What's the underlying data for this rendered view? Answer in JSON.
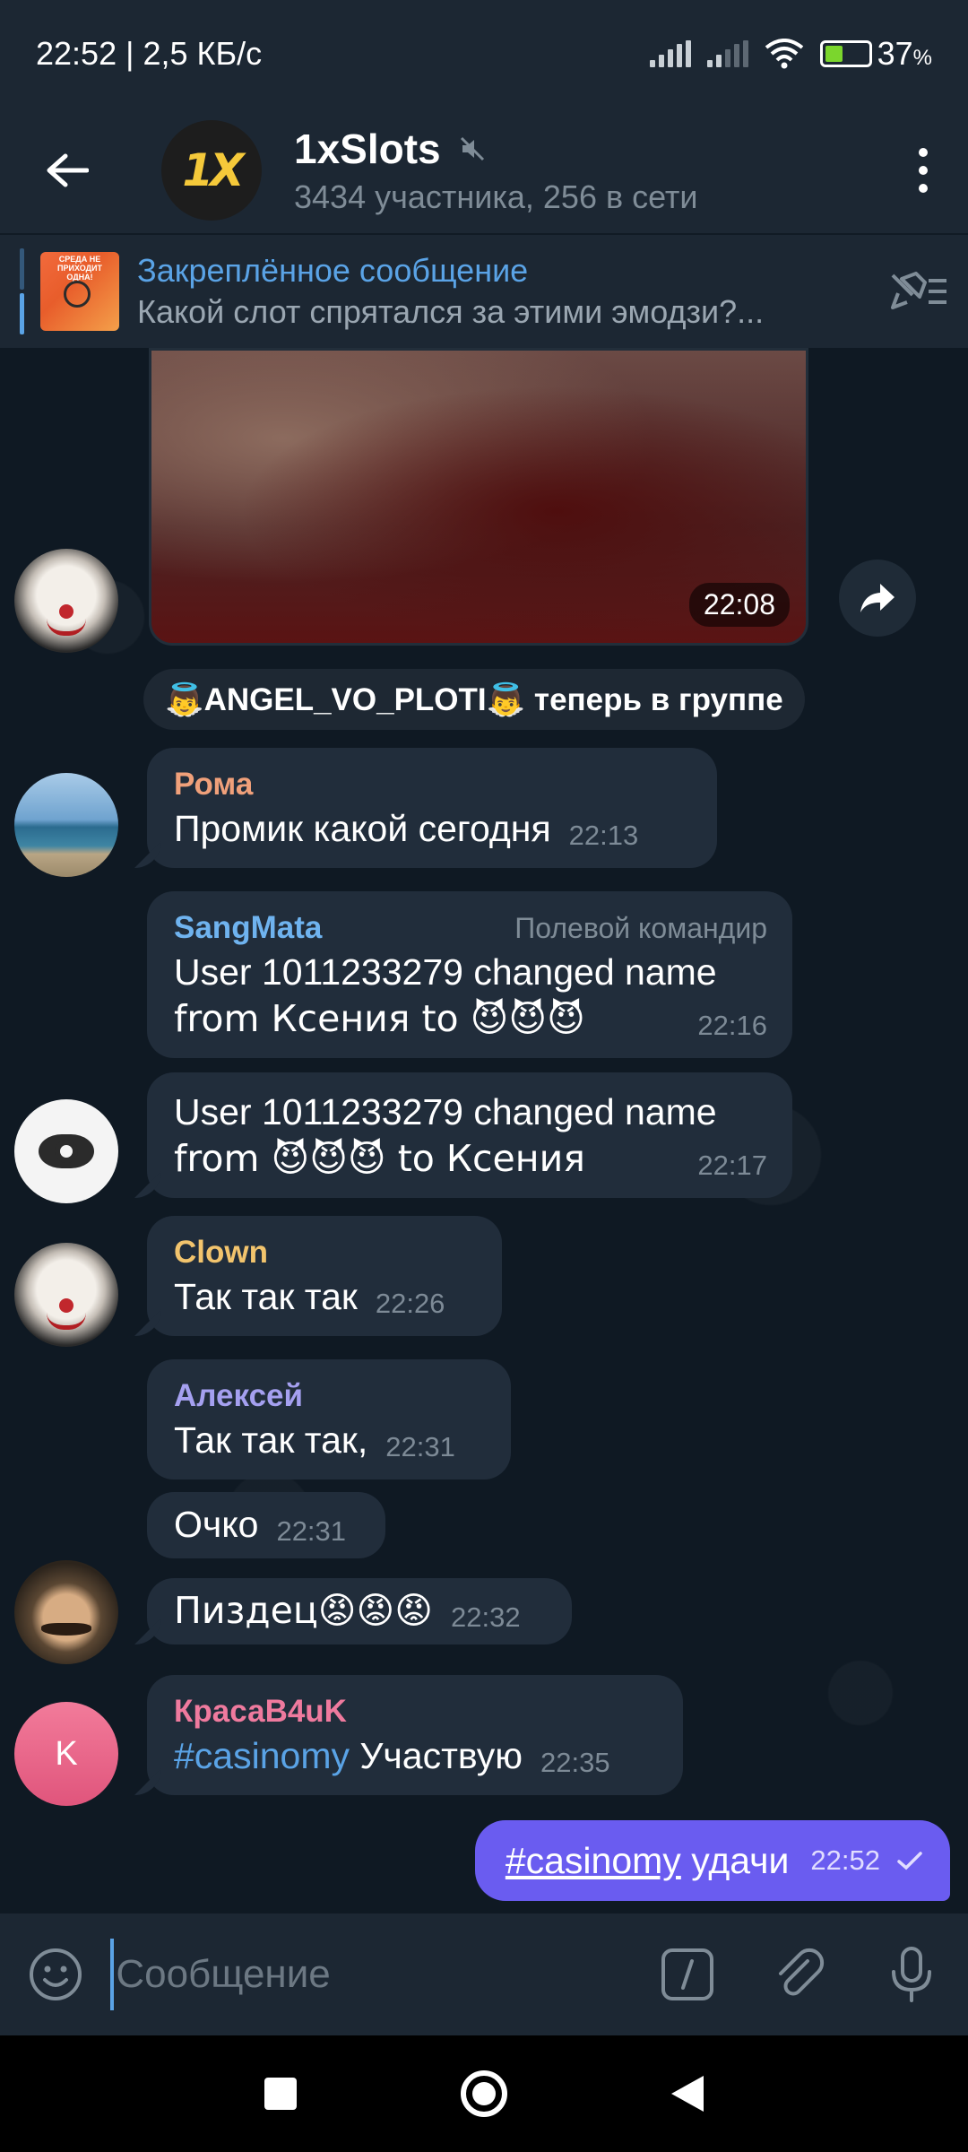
{
  "status_bar": {
    "time": "22:52 | 2,5 КБ/с",
    "battery_percent": "37",
    "battery_suffix": "%",
    "battery_level": 0.37,
    "icons": [
      "signal-icon",
      "signal-icon",
      "wifi-icon",
      "battery-icon"
    ]
  },
  "header": {
    "title": "1xSlots",
    "subtitle": "3434 участника, 256 в сети",
    "avatar_text": "1X",
    "muted": true
  },
  "pinned": {
    "title": "Закреплённое сообщение",
    "preview": "Какой слот спрятался за этими эмодзи?...",
    "thumb_text": "СРЕДА НЕ ПРИХОДИТ ОДНА!"
  },
  "media": {
    "time": "22:08"
  },
  "service": {
    "text": "👼ANGEL_VO_PLOTI👼 теперь в группе"
  },
  "messages": [
    {
      "name": "Рома",
      "name_color": "#f0a07a",
      "text": "Промик какой сегодня",
      "time": "22:13"
    },
    {
      "name": "SangMata",
      "name_color": "#6fb3ef",
      "role": "Полевой командир",
      "line1": "User 1011233279 changed name",
      "line2": "from Ксения to 😈😈😈",
      "time": "22:16"
    },
    {
      "line1": "User 1011233279 changed name",
      "line2": "from 😈😈😈 to Ксения",
      "time": "22:17"
    },
    {
      "name": "Clown",
      "name_color": "#f2c46d",
      "text": "Так так так",
      "time": "22:26"
    },
    {
      "name": "Алексей",
      "name_color": "#a5a0f0",
      "text": "Так так так,",
      "time": "22:31"
    },
    {
      "text": "Очко",
      "time": "22:31"
    },
    {
      "text": "Пиздец😡😡😡",
      "time": "22:32"
    },
    {
      "name": "КрасаВ4uK",
      "name_color": "#ef7a9e",
      "hashtag": "#casinomy",
      "text": " Участвую",
      "time": "22:35",
      "avatar_letter": "K"
    }
  ],
  "outgoing": {
    "hashtag": "#casinomy",
    "text": " удачи",
    "time": "22:52"
  },
  "input": {
    "placeholder": "Сообщение"
  },
  "colors": {
    "accent": "#5aa3e6",
    "outgoing_bubble": "#6a5cf0",
    "incoming_bubble": "#212d3b",
    "header_bg": "#1c2733"
  }
}
